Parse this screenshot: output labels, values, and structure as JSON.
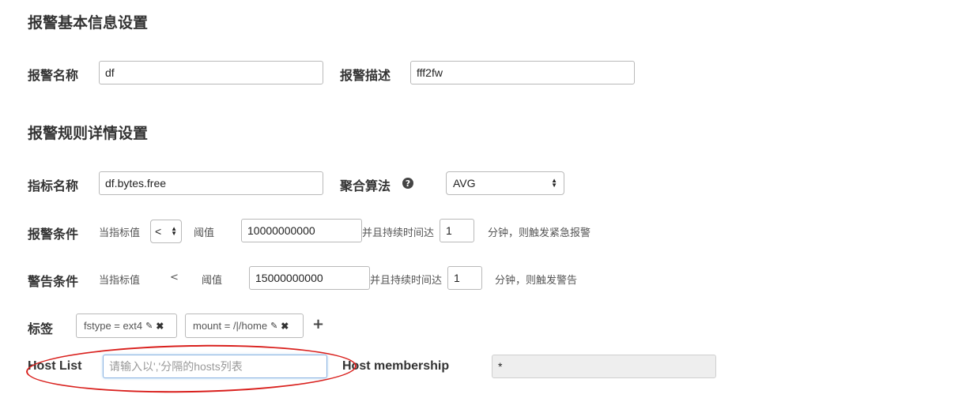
{
  "section_basic": {
    "title": "报警基本信息设置"
  },
  "alarm_name": {
    "label": "报警名称",
    "value": "df"
  },
  "alarm_desc": {
    "label": "报警描述",
    "value": "fff2fw"
  },
  "section_rules": {
    "title": "报警规则详情设置"
  },
  "metric": {
    "label": "指标名称",
    "value": "df.bytes.free"
  },
  "aggregation": {
    "label": "聚合算法",
    "help_icon": "question-circle-icon",
    "selected": "AVG"
  },
  "alarm_condition": {
    "label": "报警条件",
    "when_metric": "当指标值",
    "operator": "<",
    "threshold_label": "阈值",
    "threshold": "10000000000",
    "duration_text": "并且持续时间达",
    "duration": "1",
    "suffix": "分钟，则触发紧急报警"
  },
  "warning_condition": {
    "label": "警告条件",
    "when_metric": "当指标值",
    "operator": "<",
    "threshold_label": "阈值",
    "threshold": "15000000000",
    "duration_text": "并且持续时间达",
    "duration": "1",
    "suffix": "分钟，则触发警告"
  },
  "tags": {
    "label": "标签",
    "items": [
      {
        "text": "fstype = ext4",
        "edit_icon": "pencil-icon",
        "remove_icon": "close-icon"
      },
      {
        "text": "mount = /|/home",
        "edit_icon": "pencil-icon",
        "remove_icon": "close-icon"
      }
    ],
    "add_icon": "plus-icon"
  },
  "host_list": {
    "label": "Host List",
    "placeholder": "请输入以','分隔的hosts列表",
    "value": ""
  },
  "host_membership": {
    "label": "Host membership",
    "value": "*"
  },
  "colors": {
    "annotation_ellipse": "#d9201d",
    "focus_border": "#8db4e2"
  }
}
